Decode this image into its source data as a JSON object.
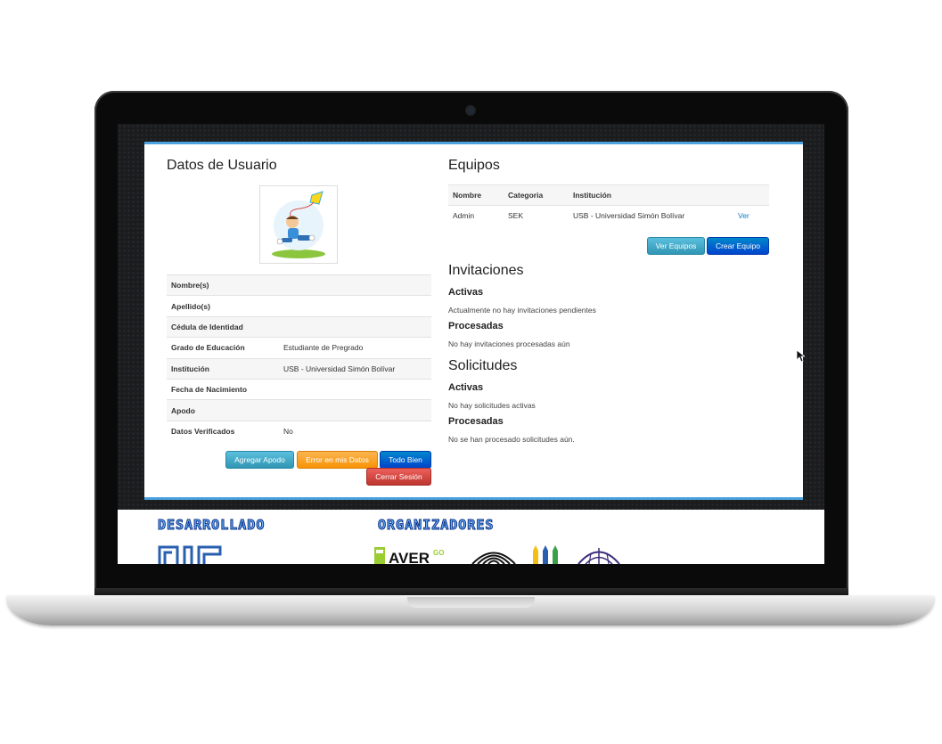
{
  "left": {
    "title": "Datos de Usuario",
    "fields": [
      {
        "label": "Nombre(s)",
        "value": ""
      },
      {
        "label": "Apellido(s)",
        "value": ""
      },
      {
        "label": "Cédula de Identidad",
        "value": ""
      },
      {
        "label": "Grado de Educación",
        "value": "Estudiante de Pregrado"
      },
      {
        "label": "Institución",
        "value": "USB - Universidad Simón Bolívar"
      },
      {
        "label": "Fecha de Nacimiento",
        "value": ""
      },
      {
        "label": "Apodo",
        "value": ""
      },
      {
        "label": "Datos Verificados",
        "value": "No"
      }
    ],
    "buttons": {
      "agregar_apodo": "Agregar Apodo",
      "error_datos": "Error en mis Datos",
      "todo_bien": "Todo Bien",
      "cerrar_sesion": "Cerrar Sesión"
    }
  },
  "right": {
    "equipos_title": "Equipos",
    "table_headers": [
      "Nombre",
      "Categoria",
      "Institución"
    ],
    "table_rows": [
      {
        "nombre": "Admin",
        "categoria": "SEK",
        "institucion": "USB - Universidad Simón Bolívar",
        "action": "Ver"
      }
    ],
    "buttons": {
      "ver_equipos": "Ver Equipos",
      "crear_equipo": "Crear Equipo"
    },
    "invitaciones": {
      "title": "Invitaciones",
      "activas_label": "Activas",
      "activas_text": "Actualmente no hay invitaciones pendientes",
      "procesadas_label": "Procesadas",
      "procesadas_text": "No hay invitaciones procesadas aún"
    },
    "solicitudes": {
      "title": "Solicitudes",
      "activas_label": "Activas",
      "activas_text": "No hay solicitudes activas",
      "procesadas_label": "Procesadas",
      "procesadas_text": "No se han procesado solicitudes aún."
    }
  },
  "footer": {
    "desarrollado": "DESARROLLADO",
    "organizadores": "ORGANIZADORES"
  },
  "colors": {
    "accent_border": "#4aa3df",
    "btn_info": "#5bc0de",
    "btn_warning": "#f89406",
    "btn_primary": "#0044cc",
    "btn_danger": "#bd362f"
  }
}
